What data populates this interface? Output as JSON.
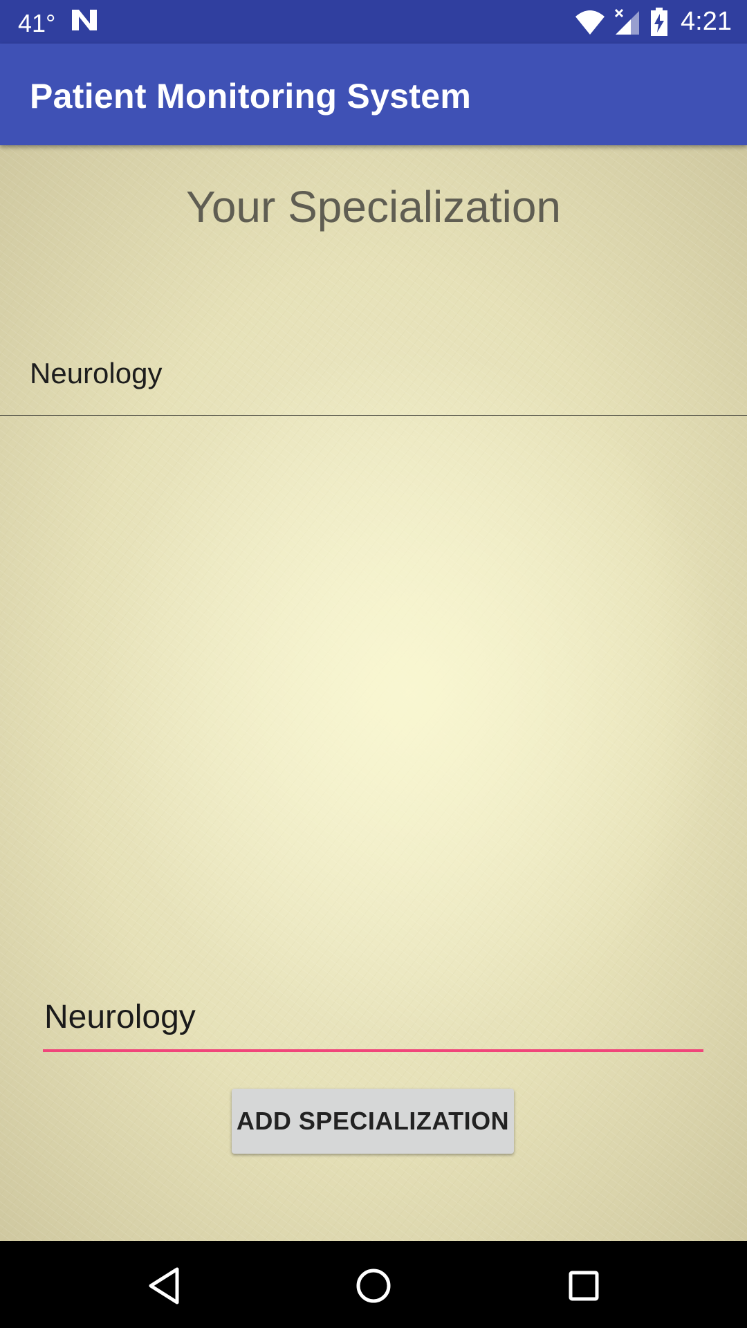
{
  "status_bar": {
    "temperature": "41°",
    "notification_icon": "n-logo-icon",
    "wifi_icon": "wifi-icon",
    "signal_icon": "cell-signal-icon",
    "battery_icon": "battery-charging-icon",
    "time": "4:21",
    "background_color": "#303F9F"
  },
  "app_bar": {
    "title": "Patient Monitoring System",
    "background_color": "#3F51B5"
  },
  "main": {
    "heading": "Your Specialization",
    "specializations": [
      {
        "label": "Neurology"
      }
    ],
    "input": {
      "value": "Neurology",
      "underline_color": "#F0457A"
    },
    "add_button_label": "ADD SPECIALIZATION"
  },
  "nav_bar": {
    "back_icon": "back-triangle-icon",
    "home_icon": "home-circle-icon",
    "recents_icon": "recents-square-icon"
  }
}
